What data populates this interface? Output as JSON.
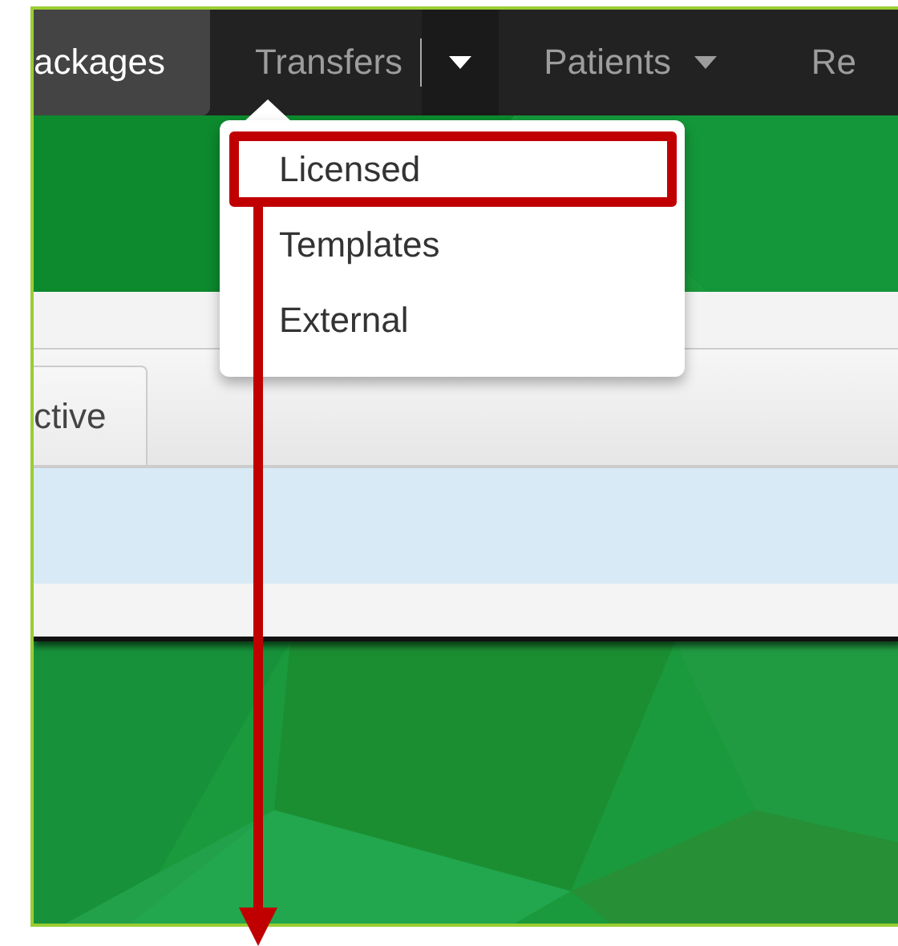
{
  "navbar": {
    "items": [
      {
        "label": "ackages",
        "kind": "link",
        "selected": true
      },
      {
        "label": "Transfers",
        "kind": "split",
        "selected": false
      },
      {
        "label": "Patients",
        "kind": "dropdown",
        "selected": false
      },
      {
        "label": "Re",
        "kind": "link",
        "selected": false
      }
    ]
  },
  "dropdown": {
    "items": [
      {
        "label": "Licensed",
        "highlighted": true
      },
      {
        "label": "Templates",
        "highlighted": false
      },
      {
        "label": "External",
        "highlighted": false
      }
    ]
  },
  "tabs": [
    {
      "label": "ctive",
      "selected": true
    }
  ],
  "table": {
    "rows": [
      {
        "selected": true
      },
      {
        "selected": false
      }
    ]
  }
}
